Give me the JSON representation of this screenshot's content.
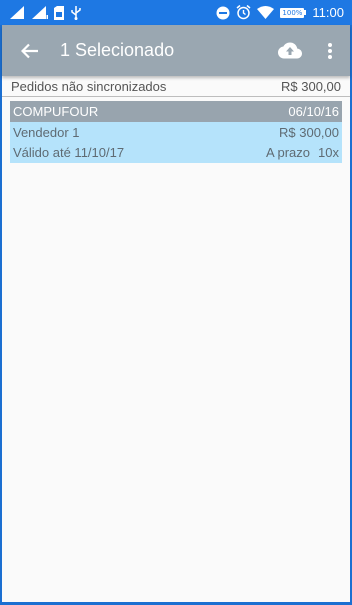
{
  "status_bar": {
    "time": "11:00",
    "battery_label": "100%",
    "icons": [
      "signal-icon",
      "signal-icon",
      "sim-icon",
      "usb-icon",
      "dnd-icon",
      "alarm-icon",
      "wifi-icon",
      "battery-icon"
    ]
  },
  "toolbar": {
    "title": "1 Selecionado",
    "icons": [
      "back-arrow-icon",
      "cloud-upload-icon",
      "more-vert-icon"
    ]
  },
  "summary": {
    "label": "Pedidos não sincronizados",
    "total": "R$ 300,00"
  },
  "order": {
    "client": "COMPUFOUR",
    "date": "06/10/16",
    "seller": "Vendedor 1",
    "amount": "R$ 300,00",
    "validity": "Válido até 11/10/17",
    "payment": "A prazo",
    "installments": "10x"
  },
  "colors": {
    "statusbar": "#1e78e3",
    "toolbar": "#9aa7b1",
    "card_header": "#98a4ae",
    "card_selected": "#b5e3fb"
  }
}
